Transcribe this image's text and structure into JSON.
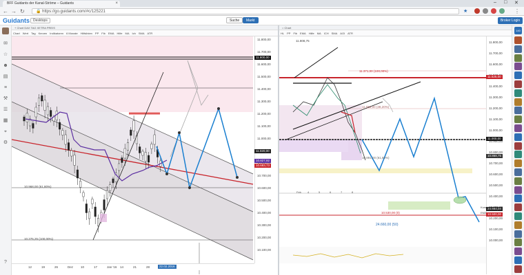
{
  "browser": {
    "tab_title": "BFF Guidants der Kanal-Ströme – Guidants",
    "url": "https://go.guidants.com/#c/125221",
    "min": "–",
    "max": "□",
    "close": "✕"
  },
  "app": {
    "logo": "Guidants",
    "desktop_label": "Desktops",
    "search_label": "Suche",
    "market_label": "Markt",
    "broker_label": "Broker Login",
    "badge": "140"
  },
  "left_chart": {
    "header": "+ Chart DAX TAG XETRA PREIS",
    "toolbar": [
      "Chart",
      "Wert",
      "Tag",
      "Kerzen",
      "Indikatoren",
      "6 Monate",
      "Hilfslinien",
      "PP",
      "Fib",
      "EMA",
      "Hilfe",
      "MA",
      "Ich",
      "SMA",
      "ATR"
    ],
    "legend": [
      "DAX (XETRA, Last) ○ 10.681,75 | H 11.045,41 | L 10.593,13 | 10.683,73",
      "EMA(20) ○ 11.115,22",
      "KAMA (20, 02, 20) ○ 10.827,92 | 10.715,83 | 10.743,09 | 10.658,73",
      "07.11.2016 – 10.03.2016"
    ],
    "price_labels": [
      "11.800,00",
      "11.700,00",
      "11.600,00",
      "11.500,00",
      "11.400,00",
      "11.300,00",
      "11.200,00",
      "11.100,00",
      "11.000,00",
      "10.900,00",
      "10.800,00",
      "10.700,00",
      "10.600,00",
      "10.500,00",
      "10.400,00",
      "10.300,00",
      "10.200,00",
      "10.100,00"
    ],
    "tag_top": "11.800,00",
    "tag_mid": "11.020,00",
    "tag_current": "10.827,92",
    "tag_low": "10.683,73",
    "fib_1": "10.968,00 (61,80%)",
    "fib_2": "10.275,25 (100,00%)",
    "dates": [
      "12",
      "19",
      "26",
      "Dez",
      "10",
      "17",
      "Jan '16",
      "14",
      "21",
      "28",
      "Feb"
    ],
    "date_marker": "22.02.2016"
  },
  "right_chart": {
    "header": "○ Chart",
    "toolbar": [
      "HL",
      "PP",
      "Fib",
      "EMA",
      "Hilfe",
      "MA",
      "ICH",
      "SMA",
      "AOI",
      "ATR"
    ],
    "top_value": "11.808,75",
    "price_labels": [
      "11.800,00",
      "11.700,00",
      "11.600,00",
      "11.500,00",
      "11.400,00",
      "11.300,00",
      "11.200,00",
      "11.100,00",
      "11.000,00",
      "10.900,00",
      "10.800,00",
      "10.700,00",
      "10.600,00",
      "10.500,00",
      "10.400,00",
      "10.300,00",
      "10.200,00",
      "10.100,00",
      "10.000,00"
    ],
    "fib_top": "11.371,00 (100,00%)",
    "fib_38": "11.052,00 (38,20%)",
    "fib_lower": "10.891,00 (61,80%)",
    "red_level": "11.525,00",
    "black_level": "11.000,00",
    "mid_label": "10.868,75",
    "lower_red": "10.500,00",
    "support_label": "10.530,00 (0)",
    "support_label_2": "24.660,00 (50)",
    "right_small": "Kursziel",
    "right_small_2": "EMA200 Tag",
    "value_right": "24.664,04",
    "lower_axis": [
      "24.600,00",
      "24.400,00",
      "24.200,00",
      "10.000,00"
    ],
    "osc_values": [
      "40,00",
      "20,00",
      "0,00"
    ],
    "bottom_dates": [
      "Feb",
      "4",
      "5",
      "6",
      "7",
      "8"
    ]
  },
  "rightbar_avatars": [
    "#b0522c",
    "#4a6e9c",
    "#6a7f43",
    "#7a4c8f",
    "#2d6fb5",
    "#9c3d3d",
    "#2f8a7a",
    "#b07d2c",
    "#4a6e9c",
    "#6a7f43",
    "#7a4c8f",
    "#2d6fb5",
    "#9c3d3d",
    "#2f8a7a",
    "#b07d2c",
    "#4a6e9c",
    "#6a7f43",
    "#7a4c8f",
    "#2d6fb5",
    "#9c3d3d",
    "#2f8a7a",
    "#b07d2c",
    "#4a6e9c",
    "#6a7f43",
    "#7a4c8f",
    "#2d6fb5",
    "#9c3d3d"
  ],
  "colors": {
    "accent": "#2d6fb5",
    "projection": "#1a7fd0",
    "kama": "#5a2ca0",
    "ema": "#c8242b",
    "channel_fill": "#d9d4da"
  }
}
